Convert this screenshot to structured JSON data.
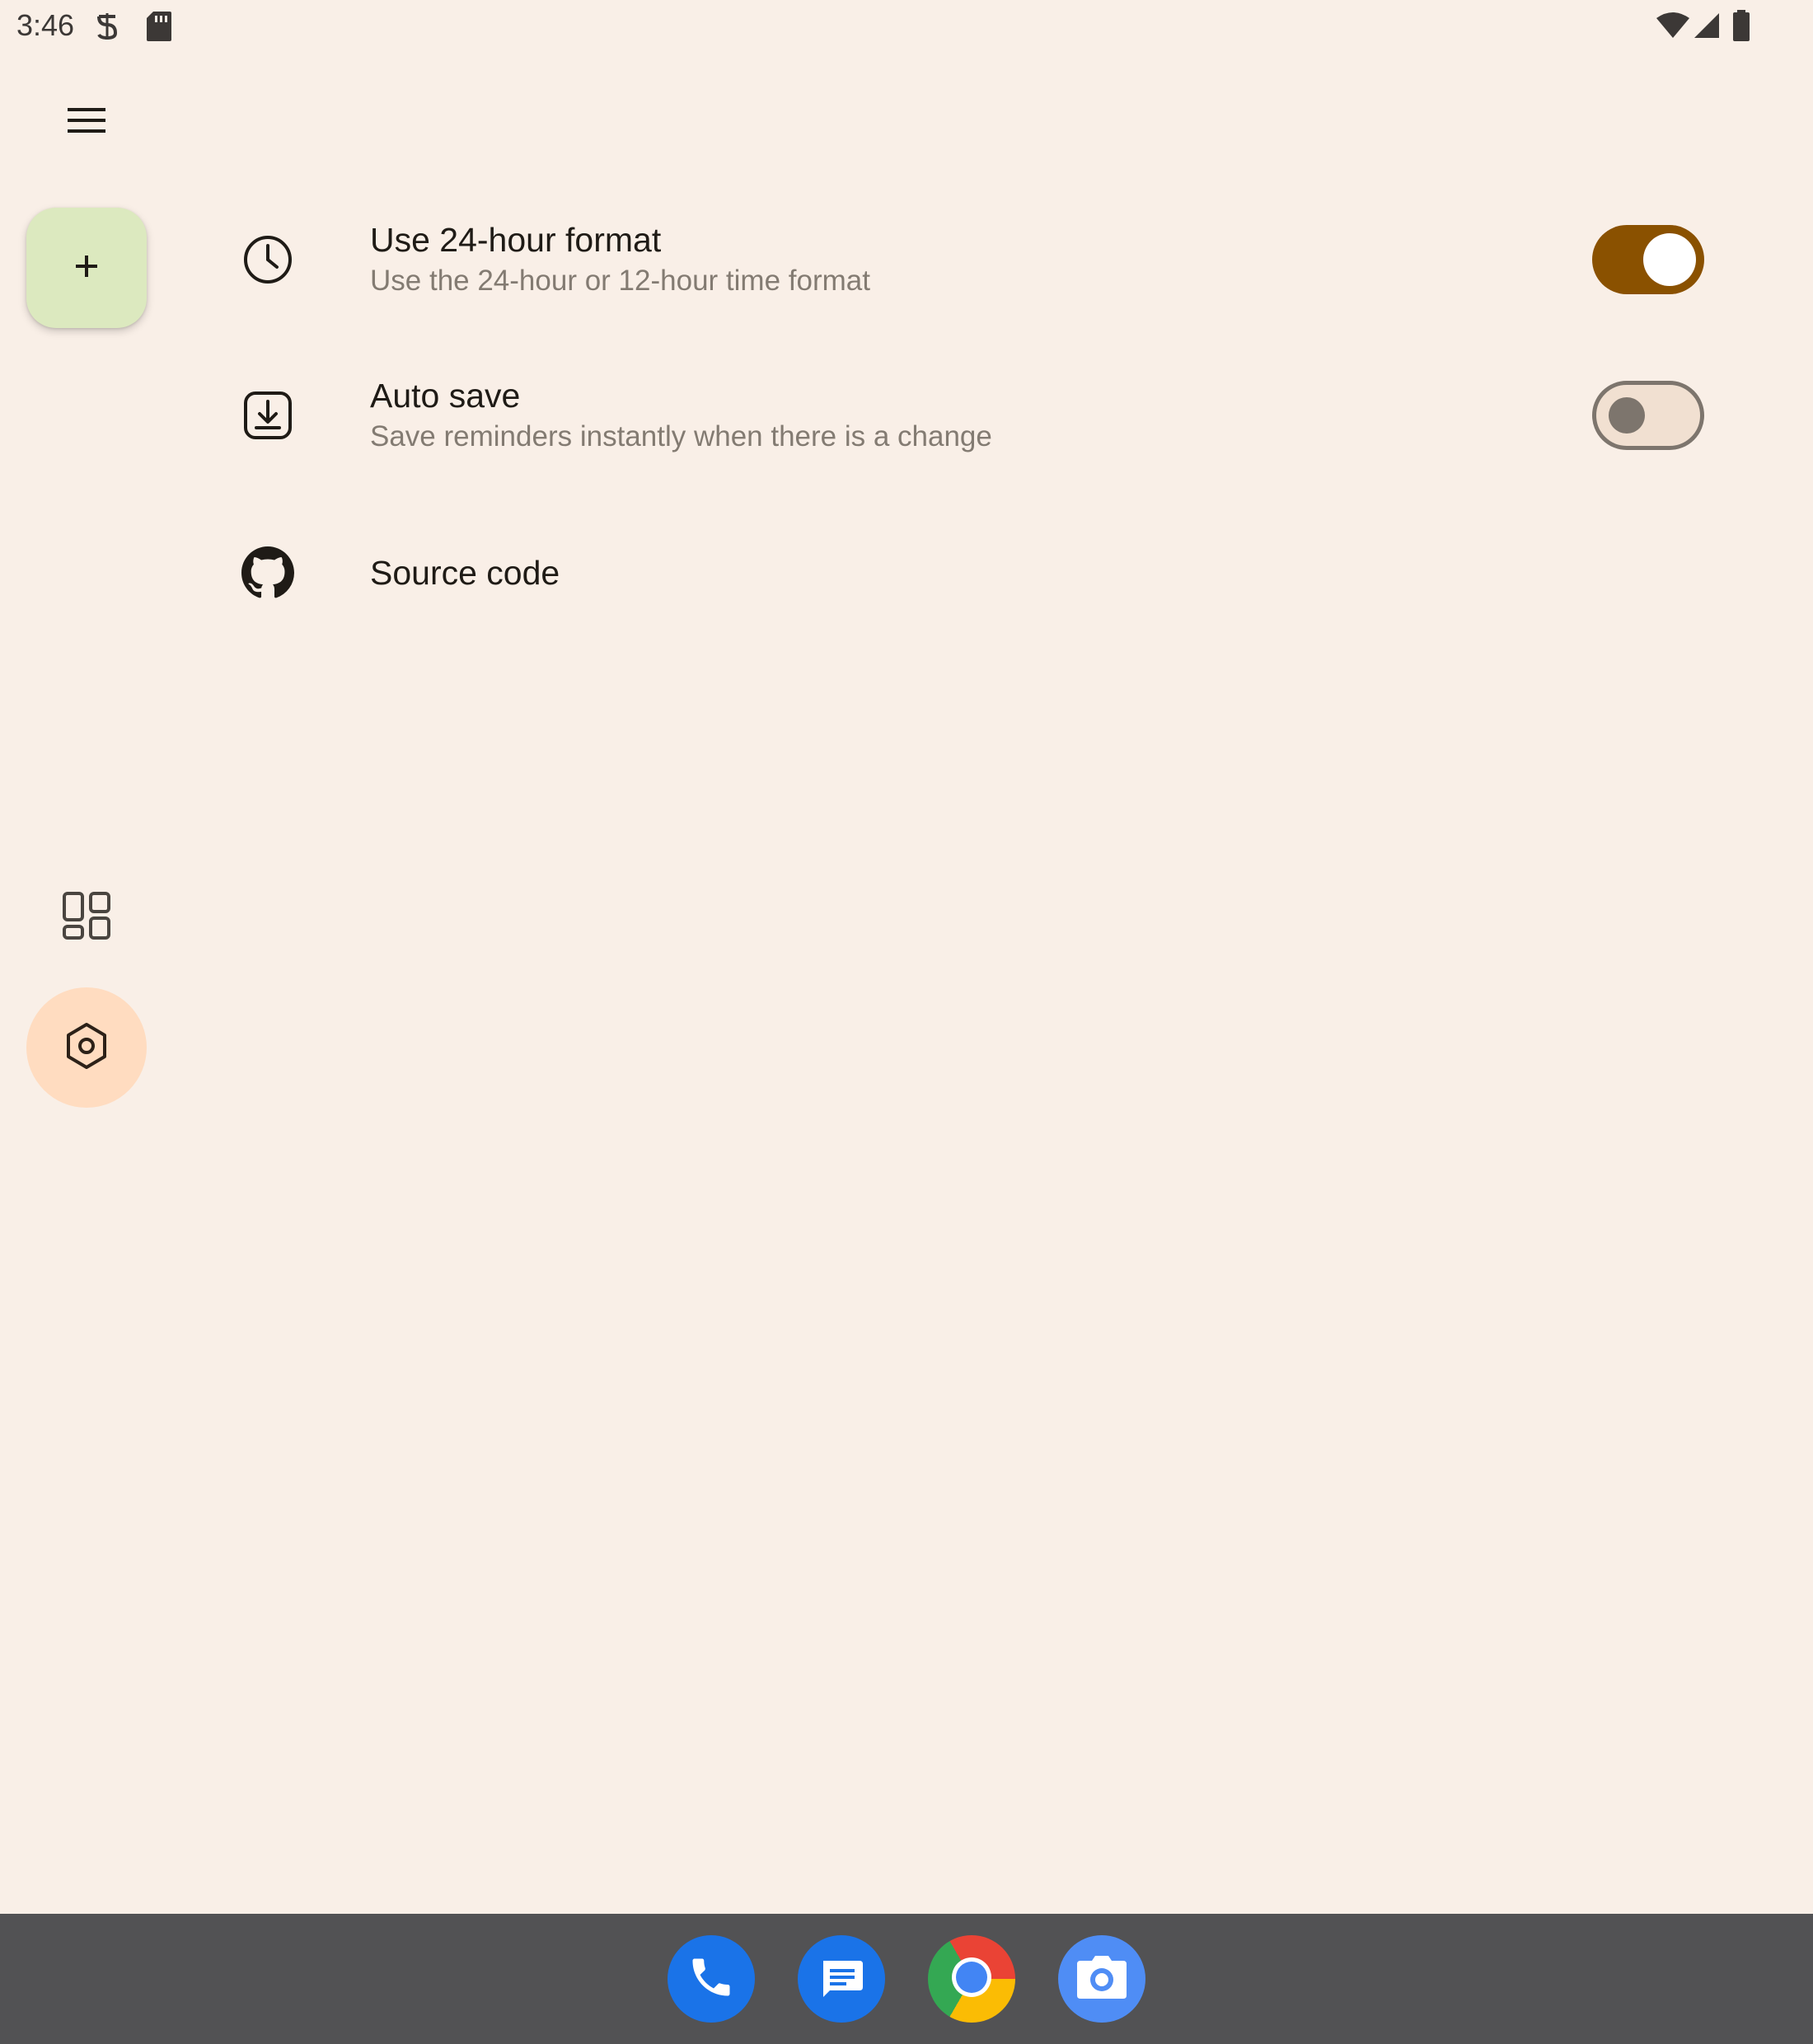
{
  "status_bar": {
    "time": "3:46"
  },
  "nav_rail": {
    "menu_icon": "menu-icon",
    "fab_icon": "add-icon",
    "items": [
      {
        "name": "widgets",
        "icon": "dashboard-icon",
        "active": false
      },
      {
        "name": "settings",
        "icon": "settings-icon",
        "active": true
      }
    ]
  },
  "settings": {
    "items": [
      {
        "icon": "clock-icon",
        "title": "Use 24-hour format",
        "subtitle": "Use the 24-hour or 12-hour time format",
        "toggle": true
      },
      {
        "icon": "download-icon",
        "title": "Auto save",
        "subtitle": "Save reminders instantly when there is a change",
        "toggle": false
      },
      {
        "icon": "github-icon",
        "title": "Source code"
      }
    ]
  },
  "dock": {
    "apps": [
      "phone-icon",
      "messages-icon",
      "chrome-icon",
      "camera-icon"
    ]
  },
  "colors": {
    "background": "#f9efe7",
    "fab": "#dce9bf",
    "active_rail": "#ffdcc0",
    "switch_on": "#8a5100",
    "dock": "#525254"
  }
}
